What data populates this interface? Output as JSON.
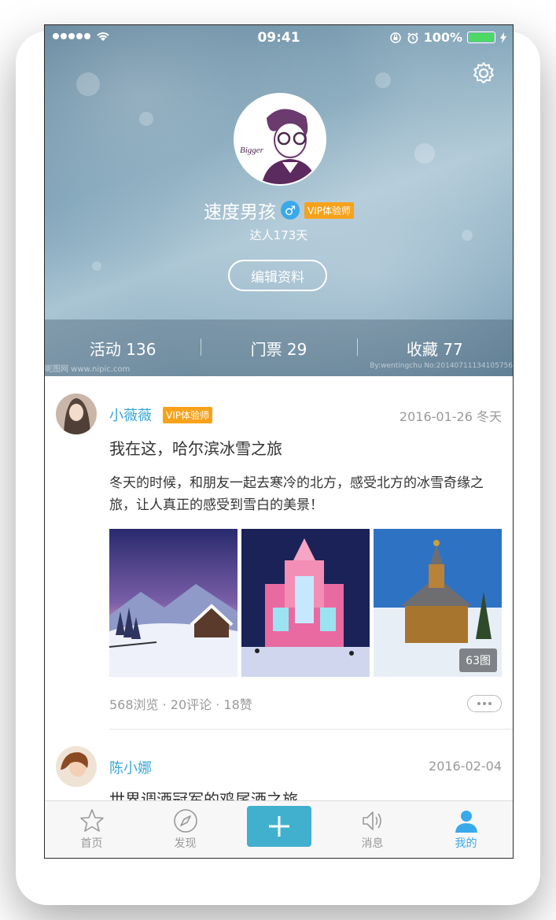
{
  "status_bar": {
    "time": "09:41",
    "battery": "100%"
  },
  "profile": {
    "name": "速度男孩",
    "gender_symbol": "♂",
    "vip_badge": "VIP体验师",
    "days": "达人173天",
    "edit_button": "编辑资料",
    "avatar_text": "Bigger"
  },
  "stats": [
    {
      "label": "活动 136"
    },
    {
      "label": "门票 29"
    },
    {
      "label": "收藏 77"
    }
  ],
  "watermark": {
    "left": "昵图网 www.nipic.com",
    "right": "By:wentingchu No:20140711134105756"
  },
  "posts": [
    {
      "author": "小薇薇",
      "vip": "VIP体验师",
      "date": "2016-01-26 冬天",
      "title": "我在这，哈尔滨冰雪之旅",
      "body": "冬天的时候，和朋友一起去寒冷的北方，感受北方的冰雪奇缘之旅，让人真正的感受到雪白的美景！",
      "photo_count": "63图",
      "meta": "568浏览 · 20评论 · 18赞"
    },
    {
      "author": "陈小娜",
      "date": "2016-02-04",
      "title": "世界调酒冠军的鸡尾酒之旅"
    }
  ],
  "tabs": [
    {
      "label": "首页",
      "icon": "star-icon"
    },
    {
      "label": "发现",
      "icon": "compass-icon"
    },
    {
      "label": "",
      "icon": "plus-icon"
    },
    {
      "label": "消息",
      "icon": "speaker-icon"
    },
    {
      "label": "我的",
      "icon": "person-icon"
    }
  ],
  "colors": {
    "accent": "#3aa9ea",
    "add_button": "#41b0ce",
    "vip": "#f7a21b"
  }
}
